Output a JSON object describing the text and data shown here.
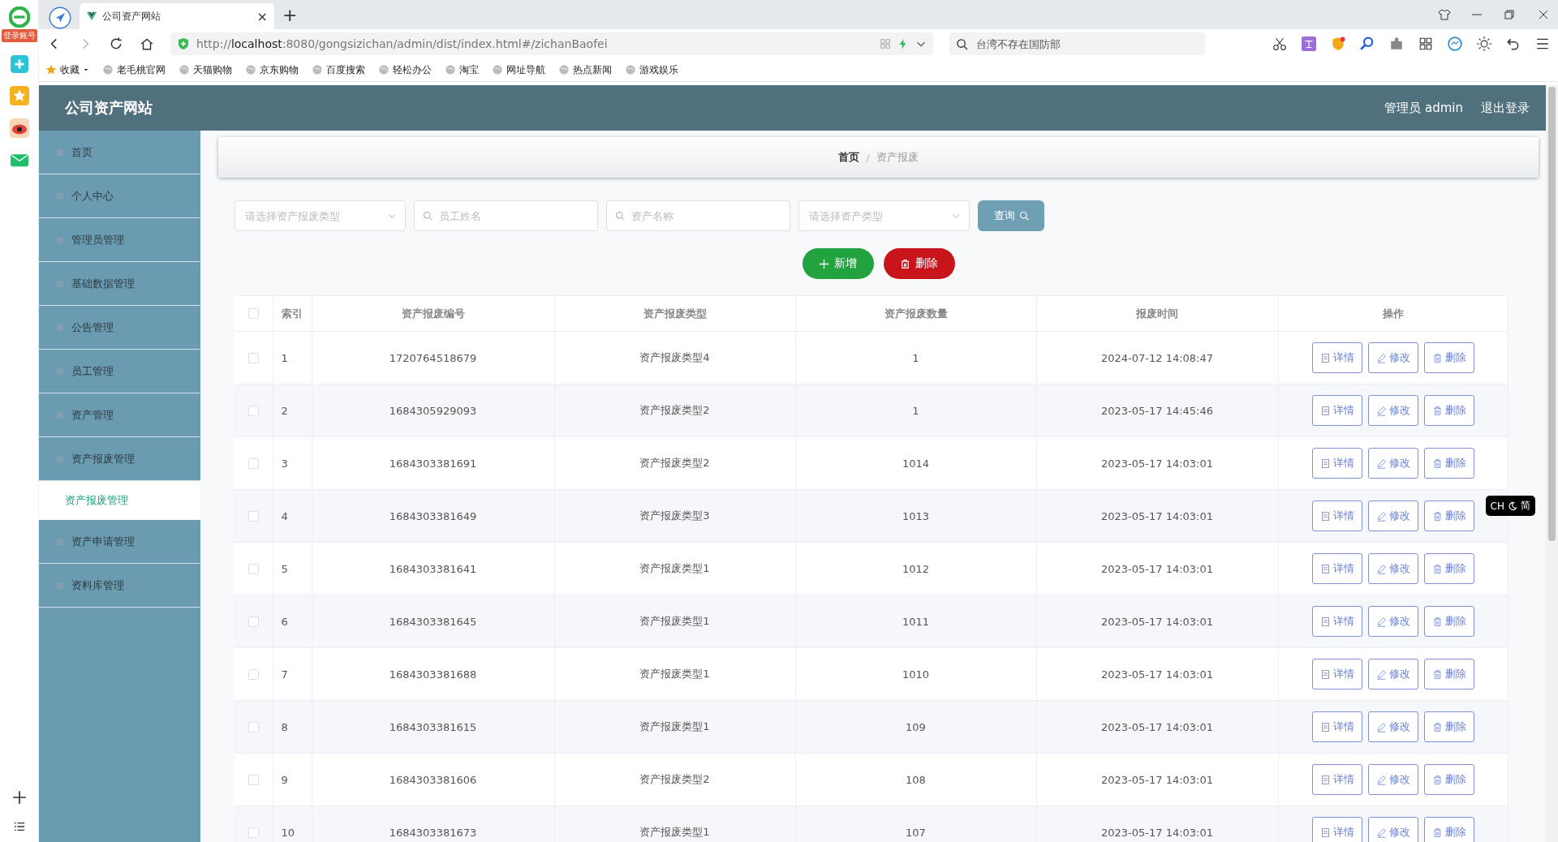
{
  "browser": {
    "login_badge": "登录账号",
    "tab_title": "公司资产网站",
    "tab_close": "×",
    "new_tab": "+",
    "url": "http://**localhost**:8080/gongsizichan/admin/dist/index.html#/zichanBaofei",
    "search_placeholder": "台湾不存在国防部",
    "bookmarks": [
      "收藏",
      "老毛桃官网",
      "天猫购物",
      "京东购物",
      "百度搜索",
      "轻松办公",
      "淘宝",
      "网址导航",
      "热点新闻",
      "游戏娱乐"
    ]
  },
  "header": {
    "title": "公司资产网站",
    "user": "管理员 admin",
    "logout": "退出登录"
  },
  "sidebar": {
    "items": [
      {
        "label": "首页",
        "selected": false
      },
      {
        "label": "个人中心",
        "selected": false
      },
      {
        "label": "管理员管理",
        "selected": false
      },
      {
        "label": "基础数据管理",
        "selected": false
      },
      {
        "label": "公告管理",
        "selected": false
      },
      {
        "label": "员工管理",
        "selected": false
      },
      {
        "label": "资产管理",
        "selected": false
      },
      {
        "label": "资产报废管理",
        "selected": false,
        "children": [
          {
            "label": "资产报废管理",
            "selected": true
          }
        ]
      },
      {
        "label": "资产申请管理",
        "selected": false
      },
      {
        "label": "资料库管理",
        "selected": false
      }
    ]
  },
  "breadcrumb": [
    "首页",
    "/",
    "资产报废"
  ],
  "filters": [
    {
      "kind": "select",
      "placeholder": "请选择资产报废类型"
    },
    {
      "kind": "search",
      "placeholder": "员工姓名"
    },
    {
      "kind": "search",
      "placeholder": "资产名称"
    },
    {
      "kind": "select",
      "placeholder": "请选择资产类型"
    }
  ],
  "query_button": "查询",
  "add_button": "新增",
  "delete_button": "删除",
  "table": {
    "all_checked": false,
    "columns": [
      "索引",
      "资产报废编号",
      "资产报废类型",
      "资产报废数量",
      "报废时间",
      "操作"
    ],
    "rows": [
      {
        "checked": false,
        "cells": [
          "1",
          "1720764518679",
          "资产报废类型4",
          "1",
          "2024-07-12 14:08:47"
        ],
        "actions": [
          "详情",
          "修改",
          "删除"
        ]
      },
      {
        "checked": false,
        "cells": [
          "2",
          "1684305929093",
          "资产报废类型2",
          "1",
          "2023-05-17 14:45:46"
        ],
        "actions": [
          "详情",
          "修改",
          "删除"
        ]
      },
      {
        "checked": false,
        "cells": [
          "3",
          "1684303381691",
          "资产报废类型2",
          "1014",
          "2023-05-17 14:03:01"
        ],
        "actions": [
          "详情",
          "修改",
          "删除"
        ]
      },
      {
        "checked": false,
        "cells": [
          "4",
          "1684303381649",
          "资产报废类型3",
          "1013",
          "2023-05-17 14:03:01"
        ],
        "actions": [
          "详情",
          "修改",
          "删除"
        ]
      },
      {
        "checked": false,
        "cells": [
          "5",
          "1684303381641",
          "资产报废类型1",
          "1012",
          "2023-05-17 14:03:01"
        ],
        "actions": [
          "详情",
          "修改",
          "删除"
        ]
      },
      {
        "checked": false,
        "cells": [
          "6",
          "1684303381645",
          "资产报废类型1",
          "1011",
          "2023-05-17 14:03:01"
        ],
        "actions": [
          "详情",
          "修改",
          "删除"
        ]
      },
      {
        "checked": false,
        "cells": [
          "7",
          "1684303381688",
          "资产报废类型1",
          "1010",
          "2023-05-17 14:03:01"
        ],
        "actions": [
          "详情",
          "修改",
          "删除"
        ]
      },
      {
        "checked": false,
        "cells": [
          "8",
          "1684303381615",
          "资产报废类型1",
          "109",
          "2023-05-17 14:03:01"
        ],
        "actions": [
          "详情",
          "修改",
          "删除"
        ]
      },
      {
        "checked": false,
        "cells": [
          "9",
          "1684303381606",
          "资产报废类型2",
          "108",
          "2023-05-17 14:03:01"
        ],
        "actions": [
          "详情",
          "修改",
          "删除"
        ]
      },
      {
        "checked": false,
        "cells": [
          "10",
          "1684303381673",
          "资产报废类型1",
          "107",
          "2023-05-17 14:03:01"
        ],
        "actions": [
          "详情",
          "修改",
          "删除"
        ]
      }
    ]
  },
  "ime": {
    "mode": "CH",
    "script": "简"
  }
}
